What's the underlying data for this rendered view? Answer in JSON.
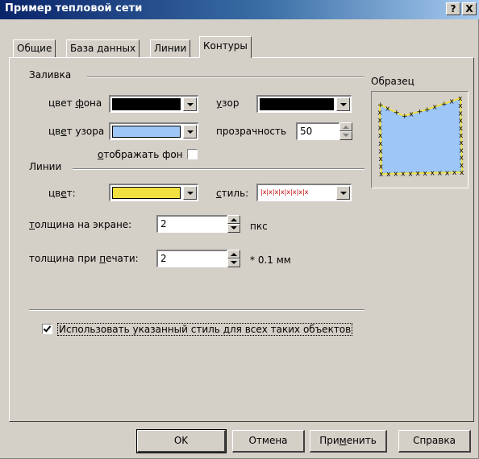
{
  "window": {
    "title": "Пример тепловой сети",
    "help_label": "?",
    "close_label": "X"
  },
  "tabs": [
    {
      "label": "Общие",
      "active": false
    },
    {
      "label": "База данных",
      "active": false
    },
    {
      "label": "Линии",
      "active": false
    },
    {
      "label": "Контуры",
      "active": true
    }
  ],
  "fill": {
    "group_label": "Заливка",
    "bg_color_label": "цвет фона",
    "bg_color": "#000000",
    "pattern_color_label": "цвет узора",
    "pattern_color": "#9ec6f6",
    "pattern_label": "узор",
    "pattern_value": "#000000",
    "transparency_label": "прозрачность",
    "transparency_value": "50",
    "show_bg_label": "отображать фон",
    "show_bg_checked": false
  },
  "lines": {
    "group_label": "Линии",
    "color_label": "цвет:",
    "color": "#f0e040",
    "style_label": "стиль:",
    "style_sample": "|x|x|x|x|x|x|x|x",
    "screen_width_label": "толщина на экране:",
    "screen_width_value": "2",
    "screen_width_unit": "пкс",
    "print_width_label": "толщина при печати:",
    "print_width_value": "2",
    "print_width_unit": "* 0.1 мм"
  },
  "sample": {
    "label": "Образец",
    "fill_color": "#9ec6f6",
    "border_color": "#f0e040"
  },
  "apply_all": {
    "label": "Использовать указанный стиль для всех таких объектов",
    "checked": true
  },
  "buttons": {
    "ok": "OK",
    "cancel": "Отмена",
    "apply": "Применить",
    "help": "Справка"
  }
}
